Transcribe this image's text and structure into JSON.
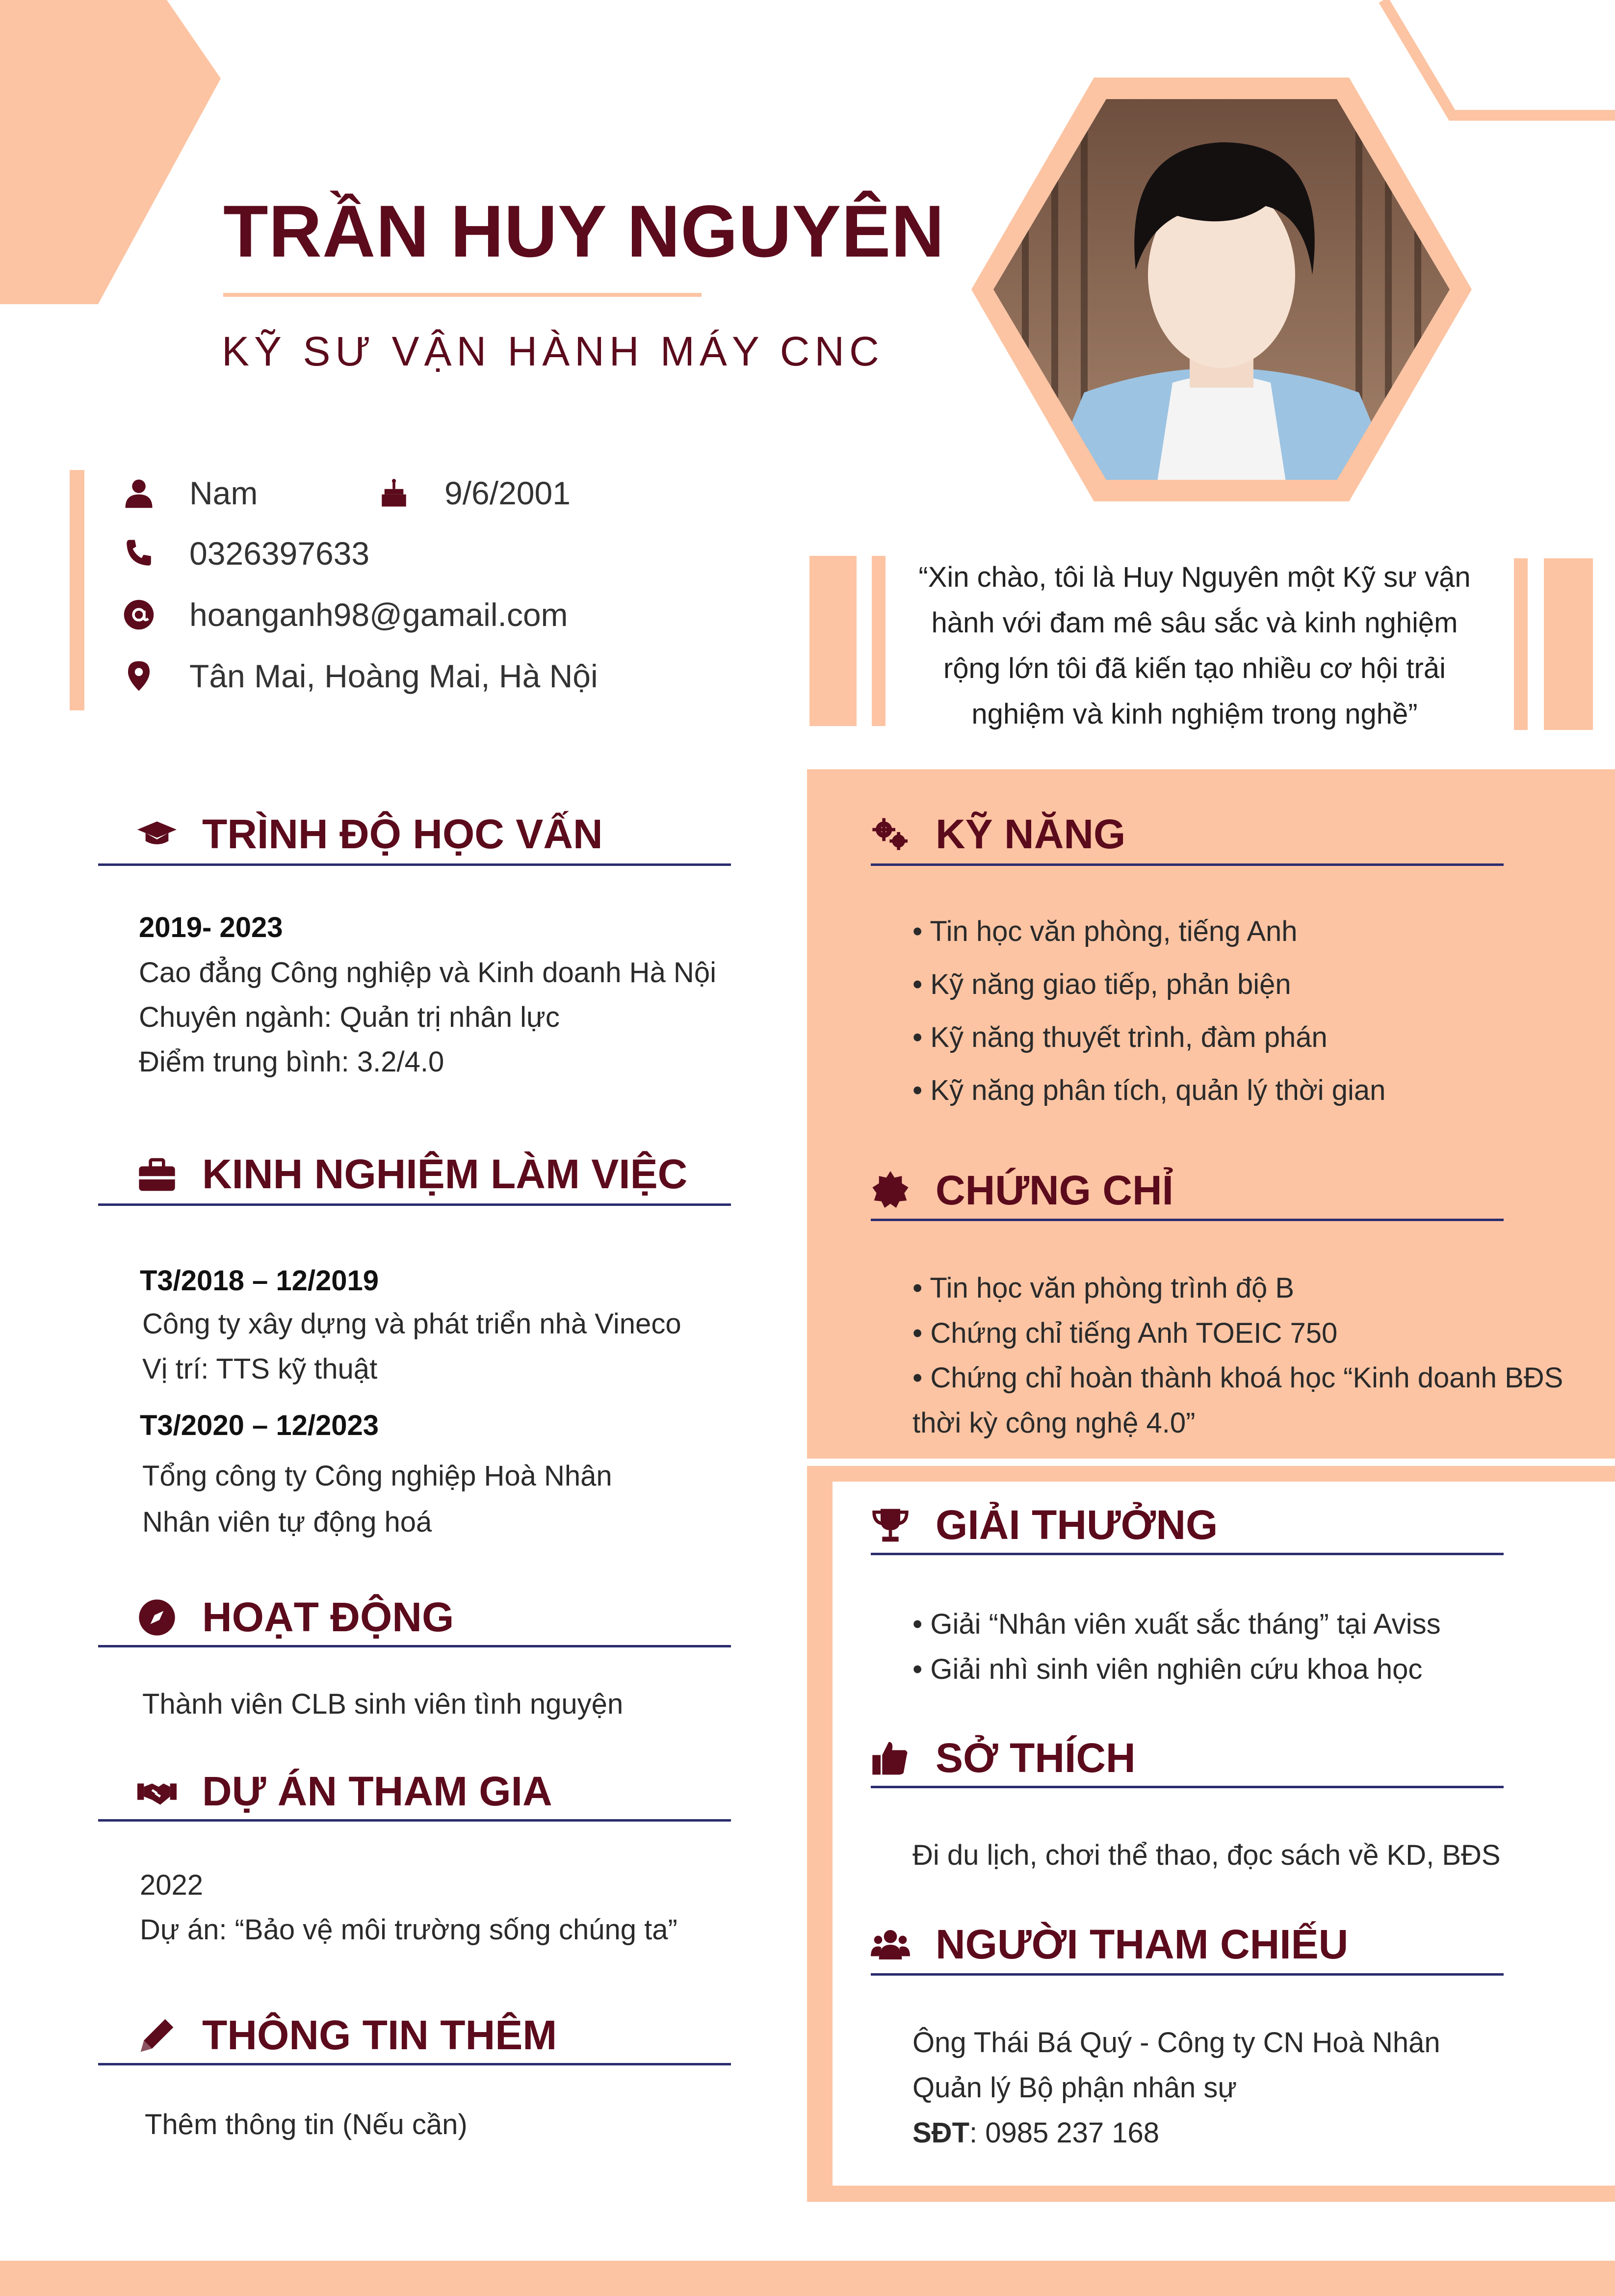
{
  "header": {
    "name": "TRẦN HUY NGUYÊN",
    "job_title": "KỸ SƯ VẬN HÀNH MÁY CNC"
  },
  "personal": {
    "gender": "Nam",
    "birthday": "9/6/2001",
    "phone": "0326397633",
    "email": "hoanganh98@gamail.com",
    "address": "Tân Mai, Hoàng Mai, Hà Nội"
  },
  "quote": [
    "“Xin chào, tôi là Huy Nguyên một Kỹ sư vận",
    "hành với đam mê sâu sắc và kinh nghiệm",
    "rộng lớn tôi đã kiến tạo nhiều cơ hội trải",
    "nghiệm và kinh nghiệm trong nghề”"
  ],
  "education": {
    "title": "TRÌNH ĐỘ HỌC VẤN",
    "period": "2019- 2023",
    "school": "Cao đẳng Công nghiệp và Kinh doanh Hà Nội",
    "major": "Chuyên ngành: Quản trị nhân lực",
    "gpa": "Điểm trung bình: 3.2/4.0"
  },
  "experience": {
    "title": "KINH NGHIỆM LÀM VIỆC",
    "jobs": [
      {
        "period": "T3/2018 – 12/2019",
        "company": "Công ty xây dựng và phát triển nhà Vineco",
        "role": "Vị trí: TTS kỹ thuật"
      },
      {
        "period": "T3/2020 – 12/2023",
        "company": "Tổng công ty Công nghiệp Hoà Nhân",
        "role": "Nhân viên tự động hoá"
      }
    ]
  },
  "activities": {
    "title": "HOẠT ĐỘNG",
    "text": "Thành viên CLB sinh viên tình nguyện"
  },
  "projects": {
    "title": "DỰ ÁN THAM GIA",
    "year": "2022",
    "text": "Dự án: “Bảo vệ môi trường sống chúng ta”"
  },
  "more_info": {
    "title": "THÔNG TIN THÊM",
    "text": "Thêm thông tin (Nếu cần)"
  },
  "skills": {
    "title": "KỸ NĂNG",
    "items": [
      "• Tin học văn phòng, tiếng Anh",
      "• Kỹ năng giao tiếp, phản biện",
      "• Kỹ năng thuyết trình, đàm phán",
      "• Kỹ năng phân tích, quản lý thời gian"
    ]
  },
  "certificates": {
    "title": "CHỨNG CHỈ",
    "items": [
      "• Tin học văn phòng trình độ B",
      "• Chứng chỉ tiếng Anh TOEIC 750",
      "• Chứng chỉ hoàn thành khoá học “Kinh doanh BĐS",
      "thời kỳ công nghệ 4.0”"
    ]
  },
  "awards": {
    "title": "GIẢI THƯỞNG",
    "items": [
      "• Giải “Nhân viên xuất sắc tháng” tại Aviss",
      "• Giải nhì sinh viên nghiên cứu khoa học"
    ]
  },
  "hobbies": {
    "title": "SỞ THÍCH",
    "text": "Đi du lịch, chơi thể thao, đọc sách về KD, BĐS"
  },
  "references": {
    "title": "NGƯỜI THAM CHIẾU",
    "line1": "Ông Thái Bá Quý - Công ty CN Hoà Nhân",
    "line2": "Quản lý Bộ phận nhân sự",
    "phone_label": "SĐT",
    "phone_value": ": 0985 237 168"
  },
  "colors": {
    "accent": "#fcc4a3",
    "title": "#5b0b1c",
    "rule": "#2b2d6e"
  }
}
